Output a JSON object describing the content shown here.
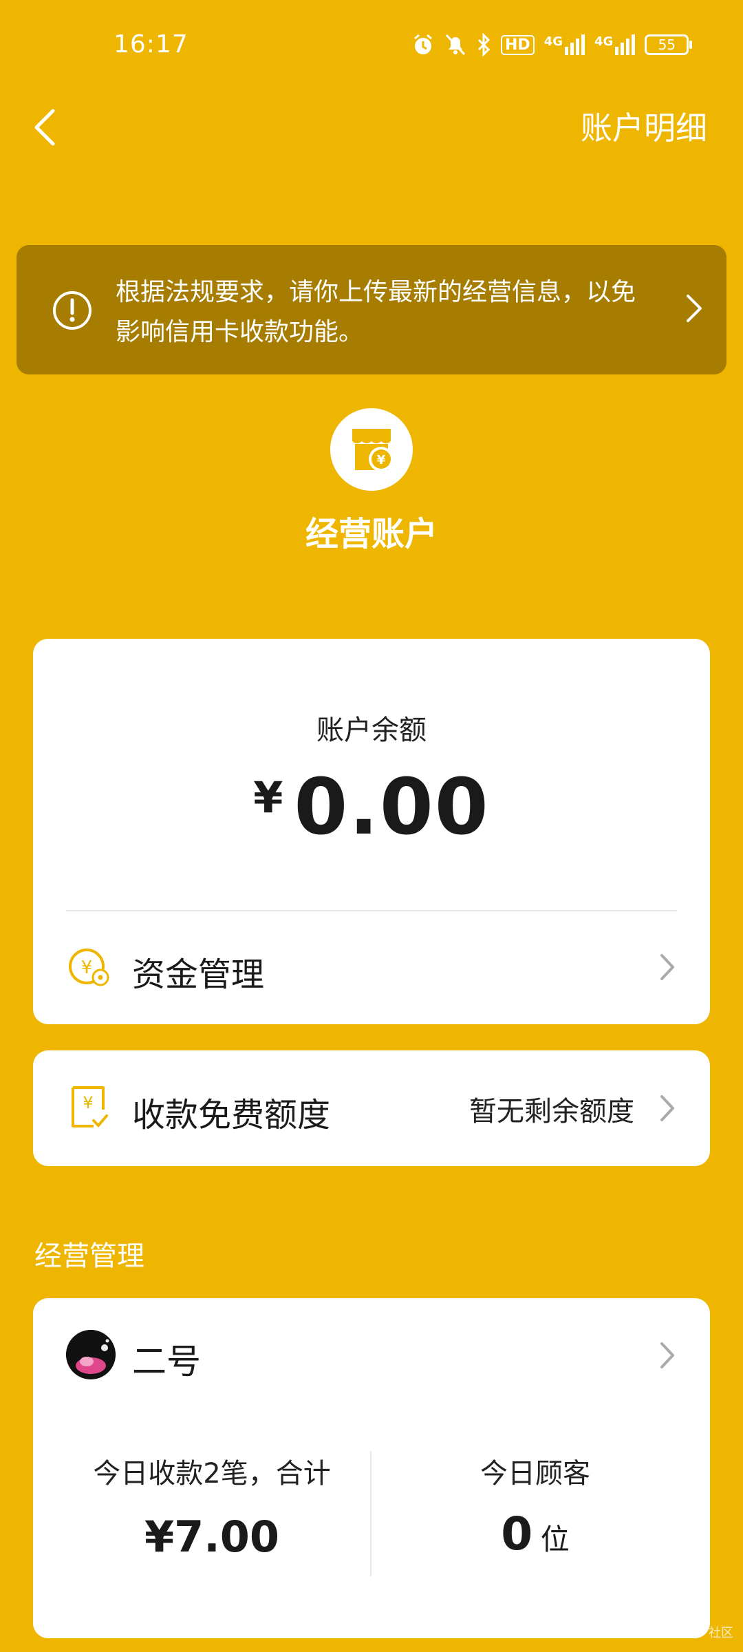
{
  "status_bar": {
    "time": "16:17",
    "icons": [
      "alarm-icon",
      "mute-icon",
      "bluetooth-icon",
      "hd-icon",
      "4g-signal-icon",
      "4g-signal-icon"
    ],
    "network1": "4G",
    "network2": "4G",
    "hd": "HD",
    "battery": "55"
  },
  "header": {
    "detail_link": "账户明细"
  },
  "notice": {
    "text": "根据法规要求，请你上传最新的经营信息，以免影响信用卡收款功能。"
  },
  "shop": {
    "title": "经营账户"
  },
  "balance": {
    "label": "账户余额",
    "currency": "¥",
    "amount": "0.00"
  },
  "fund_management": {
    "label": "资金管理"
  },
  "free_quota": {
    "label": "收款免费额度",
    "value": "暂无剩余额度"
  },
  "business": {
    "section_title": "经营管理",
    "store_name": "二号",
    "today_payments_label": "今日收款2笔，合计",
    "today_payments_value": "¥7.00",
    "today_customers_label": "今日顾客",
    "today_customers_value": "0",
    "today_customers_unit": "位"
  },
  "watermark": "社区",
  "colors": {
    "background": "#EEB600",
    "banner": "#A67D00",
    "card": "#FFFFFF",
    "accent": "#EEB600"
  }
}
